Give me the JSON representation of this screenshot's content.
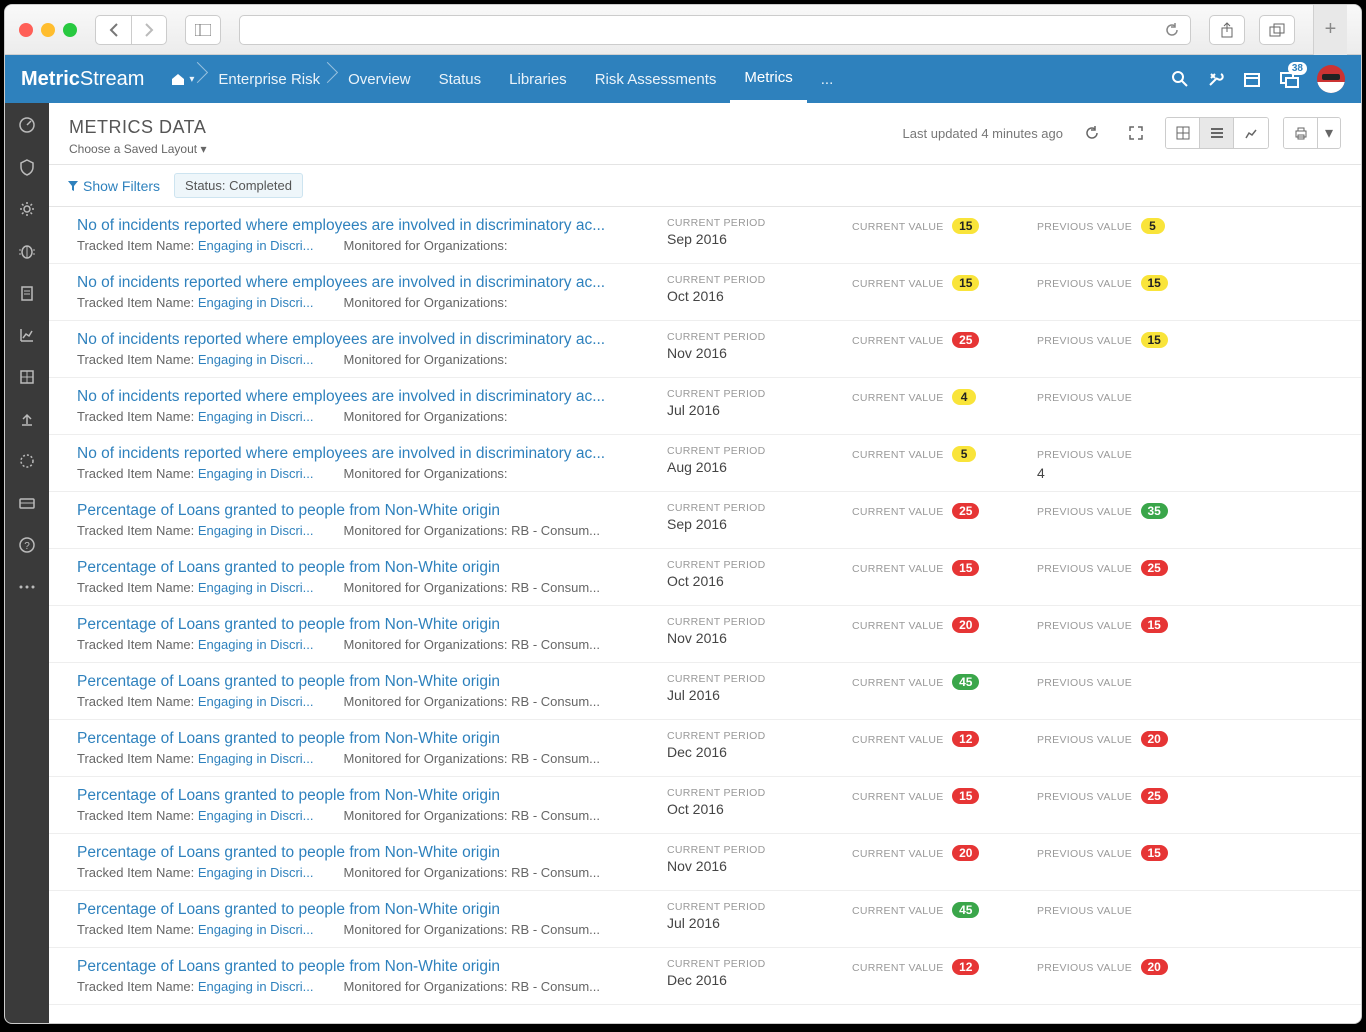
{
  "browser": {
    "new_tab": "+"
  },
  "app_name_a": "Metric",
  "app_name_b": "Stream",
  "breadcrumbs": [
    "Enterprise Risk",
    "Overview",
    "Status",
    "Libraries",
    "Risk Assessments",
    "Metrics",
    "..."
  ],
  "notification_count": "38",
  "page": {
    "title": "METRICS DATA",
    "saved_layout": "Choose a Saved Layout",
    "last_updated": "Last updated 4 minutes ago"
  },
  "filters": {
    "show": "Show Filters",
    "chip": "Status: Completed"
  },
  "labels": {
    "period": "CURRENT PERIOD",
    "current": "CURRENT VALUE",
    "previous": "PREVIOUS VALUE",
    "tracked": "Tracked Item Name:",
    "tracked_link": "Engaging in Discri...",
    "monitored": "Monitored for Organizations:",
    "monitored_rb": "Monitored for Organizations: RB - Consum..."
  },
  "rows": [
    {
      "title": "No of incidents reported where employees are involved in discriminatory ac...",
      "org": "",
      "period": "Sep 2016",
      "cur": "15",
      "cur_c": "yellow",
      "prev": "5",
      "prev_c": "yellow"
    },
    {
      "title": "No of incidents reported where employees are involved in discriminatory ac...",
      "org": "",
      "period": "Oct 2016",
      "cur": "15",
      "cur_c": "yellow",
      "prev": "15",
      "prev_c": "yellow"
    },
    {
      "title": "No of incidents reported where employees are involved in discriminatory ac...",
      "org": "",
      "period": "Nov 2016",
      "cur": "25",
      "cur_c": "red",
      "prev": "15",
      "prev_c": "yellow"
    },
    {
      "title": "No of incidents reported where employees are involved in discriminatory ac...",
      "org": "",
      "period": "Jul 2016",
      "cur": "4",
      "cur_c": "yellow",
      "prev": "",
      "prev_c": ""
    },
    {
      "title": "No of incidents reported where employees are involved in discriminatory ac...",
      "org": "",
      "period": "Aug 2016",
      "cur": "5",
      "cur_c": "yellow",
      "prev": "4",
      "prev_c": "plain"
    },
    {
      "title": "Percentage of Loans granted to people from Non-White origin",
      "org": "rb",
      "period": "Sep 2016",
      "cur": "25",
      "cur_c": "red",
      "prev": "35",
      "prev_c": "green"
    },
    {
      "title": "Percentage of Loans granted to people from Non-White origin",
      "org": "rb",
      "period": "Oct 2016",
      "cur": "15",
      "cur_c": "red",
      "prev": "25",
      "prev_c": "red"
    },
    {
      "title": "Percentage of Loans granted to people from Non-White origin",
      "org": "rb",
      "period": "Nov 2016",
      "cur": "20",
      "cur_c": "red",
      "prev": "15",
      "prev_c": "red"
    },
    {
      "title": "Percentage of Loans granted to people from Non-White origin",
      "org": "rb",
      "period": "Jul 2016",
      "cur": "45",
      "cur_c": "green",
      "prev": "",
      "prev_c": ""
    },
    {
      "title": "Percentage of Loans granted to people from Non-White origin",
      "org": "rb",
      "period": "Dec 2016",
      "cur": "12",
      "cur_c": "red",
      "prev": "20",
      "prev_c": "red"
    },
    {
      "title": "Percentage of Loans granted to people from Non-White origin",
      "org": "rb",
      "period": "Oct 2016",
      "cur": "15",
      "cur_c": "red",
      "prev": "25",
      "prev_c": "red"
    },
    {
      "title": "Percentage of Loans granted to people from Non-White origin",
      "org": "rb",
      "period": "Nov 2016",
      "cur": "20",
      "cur_c": "red",
      "prev": "15",
      "prev_c": "red"
    },
    {
      "title": "Percentage of Loans granted to people from Non-White origin",
      "org": "rb",
      "period": "Jul 2016",
      "cur": "45",
      "cur_c": "green",
      "prev": "",
      "prev_c": ""
    },
    {
      "title": "Percentage of Loans granted to people from Non-White origin",
      "org": "rb",
      "period": "Dec 2016",
      "cur": "12",
      "cur_c": "red",
      "prev": "20",
      "prev_c": "red"
    }
  ]
}
